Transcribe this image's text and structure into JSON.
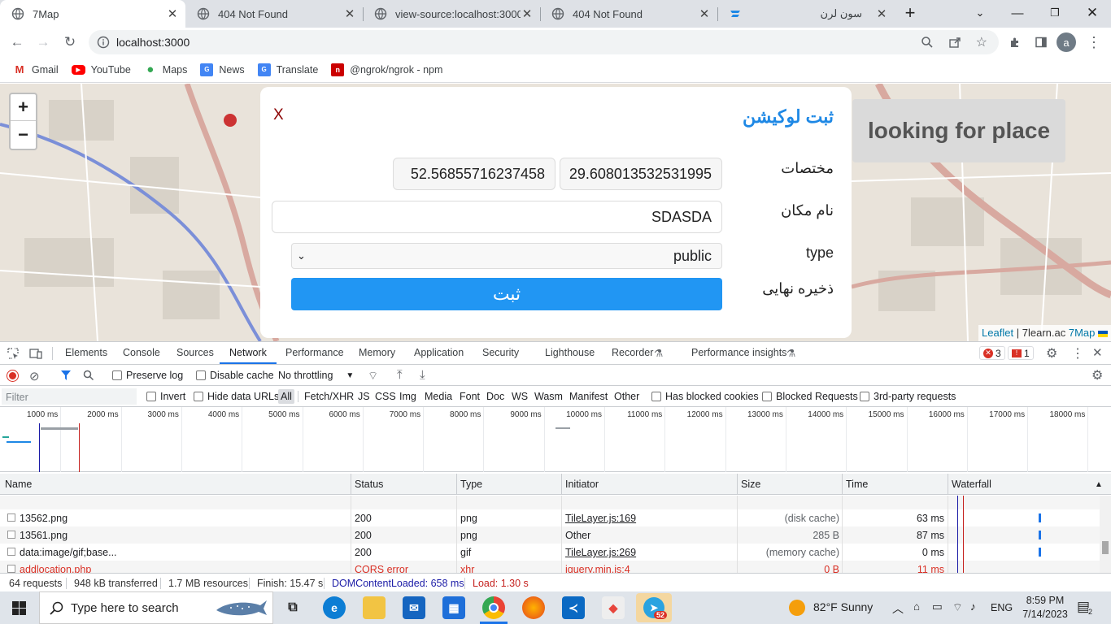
{
  "browser": {
    "tabs": [
      {
        "title": "7Map"
      },
      {
        "title": "404 Not Found"
      },
      {
        "title": "view-source:localhost:3000"
      },
      {
        "title": "404 Not Found"
      },
      {
        "title": "سون لرن"
      }
    ],
    "url": "localhost:3000",
    "profile_initial": "a",
    "bookmarks": [
      {
        "label": "Gmail"
      },
      {
        "label": "YouTube"
      },
      {
        "label": "Maps"
      },
      {
        "label": "News"
      },
      {
        "label": "Translate"
      },
      {
        "label": "@ngrok/ngrok - npm"
      }
    ]
  },
  "map": {
    "zoom_in": "+",
    "zoom_out": "−",
    "search_box": "looking for place",
    "attribution_leaflet": "Leaflet",
    "attribution_sep": "|",
    "attribution_site": "7learn.ac",
    "attribution_7map": "7Map"
  },
  "modal": {
    "title": "ثبت لوکیشن",
    "close": "X",
    "coords_label": "مختصات",
    "lat_value": "29.608013532531995",
    "lng_value": "52.56855716237458",
    "name_label": "نام مکان",
    "name_value": "SDASDA",
    "type_label": "type",
    "type_value": "public",
    "save_label": "ذخیره نهایی",
    "submit_label": "ثبت"
  },
  "devtools": {
    "tabs": [
      "Elements",
      "Console",
      "Sources",
      "Network",
      "Performance",
      "Memory",
      "Application",
      "Security",
      "Lighthouse",
      "Recorder",
      "Performance insights"
    ],
    "selected_tab": "Network",
    "errors_count": "3",
    "issues_count": "1",
    "preserve_log": "Preserve log",
    "disable_cache": "Disable cache",
    "throttling": "No throttling",
    "filter_placeholder": "Filter",
    "invert": "Invert",
    "hide_data_urls": "Hide data URLs",
    "type_filters": [
      "All",
      "Fetch/XHR",
      "JS",
      "CSS",
      "Img",
      "Media",
      "Font",
      "Doc",
      "WS",
      "Wasm",
      "Manifest",
      "Other"
    ],
    "has_blocked_cookies": "Has blocked cookies",
    "blocked_requests": "Blocked Requests",
    "third_party": "3rd-party requests",
    "timeline_ticks": [
      "1000 ms",
      "2000 ms",
      "3000 ms",
      "4000 ms",
      "5000 ms",
      "6000 ms",
      "7000 ms",
      "8000 ms",
      "9000 ms",
      "10000 ms",
      "11000 ms",
      "12000 ms",
      "13000 ms",
      "14000 ms",
      "15000 ms",
      "16000 ms",
      "17000 ms",
      "18000 ms"
    ],
    "columns": [
      "Name",
      "Status",
      "Type",
      "Initiator",
      "Size",
      "Time",
      "Waterfall"
    ],
    "rows": [
      {
        "name": "13562.png",
        "status": "200",
        "type": "png",
        "initiator": "TileLayer.js:169",
        "size": "(disk cache)",
        "time": "63 ms",
        "error": false
      },
      {
        "name": "13561.png",
        "status": "200",
        "type": "png",
        "initiator": "Other",
        "size": "285 B",
        "time": "87 ms",
        "error": false
      },
      {
        "name": "data:image/gif;base...",
        "status": "200",
        "type": "gif",
        "initiator": "TileLayer.js:269",
        "size": "(memory cache)",
        "time": "0 ms",
        "error": false
      },
      {
        "name": "addlocation.php",
        "status": "CORS error",
        "type": "xhr",
        "initiator": "jquery.min.js:4",
        "size": "0 B",
        "time": "11 ms",
        "error": true
      }
    ],
    "status": {
      "requests": "64 requests",
      "transferred": "948 kB transferred",
      "resources": "1.7 MB resources",
      "finish": "Finish: 15.47 s",
      "dcl": "DOMContentLoaded: 658 ms",
      "load": "Load: 1.30 s"
    }
  },
  "taskbar": {
    "search_placeholder": "Type here to search",
    "weather": "82°F  Sunny",
    "lang": "ENG",
    "time": "8:59 PM",
    "date": "7/14/2023",
    "telegram_badge": "52",
    "notif_count": "2"
  },
  "colors": {
    "accent": "#1e88e5",
    "submit": "#2196f3",
    "error": "#d93025",
    "dcl_blue": "#1a1aa6",
    "load_red": "#c5221f"
  }
}
